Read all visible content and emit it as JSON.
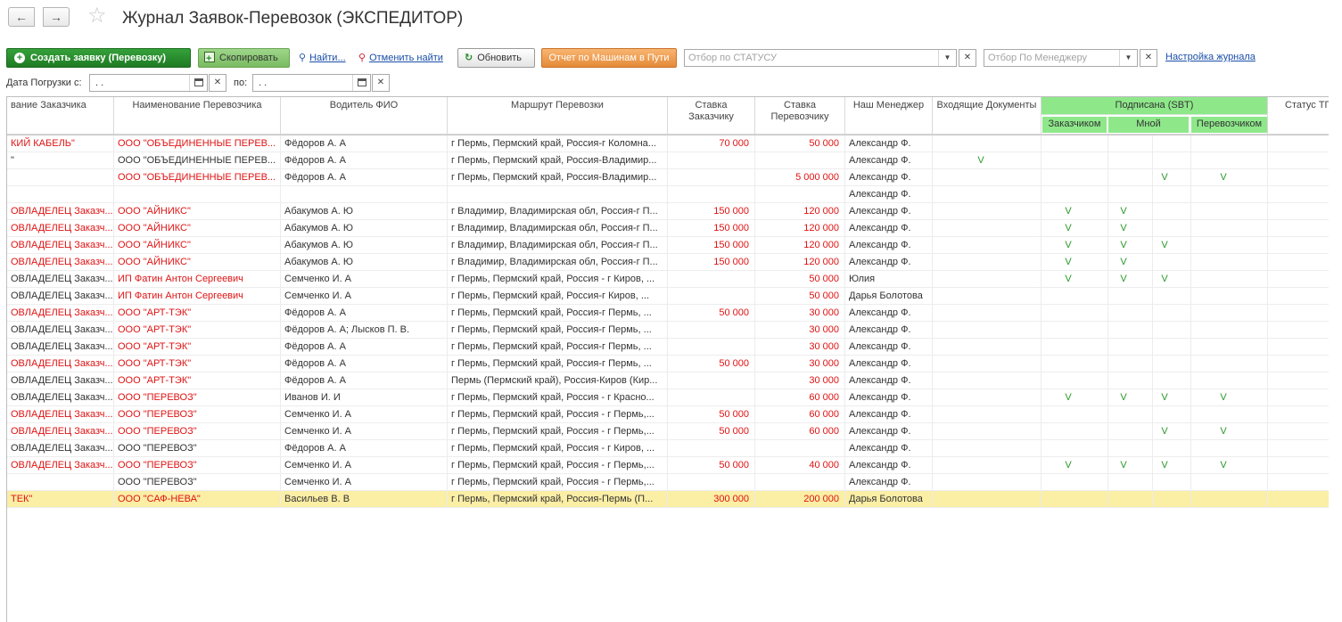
{
  "window": {
    "title": "Журнал Заявок-Перевозок (ЭКСПЕДИТОР)"
  },
  "toolbar": {
    "create_label": "Создать заявку (Перевозку)",
    "copy_label": "Скопировать",
    "find_label": "Найти...",
    "cancel_find_label": "Отменить найти",
    "refresh_label": "Обновить",
    "report_label": "Отчет по Машинам в Пути",
    "status_filter_placeholder": "Отбор по СТАТУСУ",
    "manager_filter_placeholder": "Отбор По Менеджеру",
    "settings_label": "Настройка журнала"
  },
  "dates": {
    "from_label": "Дата Погрузки с:",
    "from_value": ". .",
    "to_label": "по:",
    "to_value": ". ."
  },
  "icons": {
    "back": "arrow-left-icon",
    "forward": "arrow-right-icon",
    "favorite": "star-icon",
    "create": "plus-circle-icon",
    "copy": "copy-icon",
    "find": "magnifier-icon",
    "cancel_find": "magnifier-cross-icon",
    "refresh": "refresh-icon",
    "calendar": "calendar-icon",
    "clear": "close-icon",
    "dropdown": "chevron-down-icon"
  },
  "colors": {
    "accent_green": "#2a8c2f",
    "report_orange": "#e58a38",
    "signed_header_green": "#8ee88a",
    "red_text": "#e01313",
    "selected_row": "#fbeea5",
    "check_green": "#2a9a2a"
  },
  "table": {
    "headers": {
      "customer": "вание Заказчика",
      "carrier": "Наименование Перевозчика",
      "driver": "Водитель ФИО",
      "route": "Маршрут Перевозки",
      "rate_customer_1": "Ставка",
      "rate_customer_2": "Заказчику",
      "rate_carrier_1": "Ставка",
      "rate_carrier_2": "Перевозчику",
      "manager": "Наш Менеджер",
      "docs": "Входящие Документы",
      "signed": "Подписана (SBT)",
      "signed_customer": "Заказчиком",
      "signed_me": "Мной",
      "signed_carrier": "Перевозчиком",
      "status": "Статус ТП"
    },
    "rows": [
      {
        "customer": "КИЙ КАБЕЛЬ\"",
        "customer_red": true,
        "carrier": "ООО \"ОБЪЕДИНЕННЫЕ ПЕРЕВ...",
        "carrier_red": true,
        "driver": "Фёдоров А. А",
        "route": "г Пермь,  Пермский край, Россия-г Коломна...",
        "rate_customer": "70 000",
        "rate_carrier": "50 000",
        "manager": "Александр Ф.",
        "docs": "",
        "s1": "",
        "s2": "",
        "s3": "",
        "s4": ""
      },
      {
        "customer": "\"",
        "customer_red": false,
        "carrier": "ООО \"ОБЪЕДИНЕННЫЕ ПЕРЕВ...",
        "carrier_red": false,
        "driver": "Фёдоров А. А",
        "route": "г Пермь,  Пермский край, Россия-Владимир...",
        "rate_customer": "",
        "rate_carrier": "",
        "manager": "Александр Ф.",
        "docs": "V",
        "s1": "",
        "s2": "",
        "s3": "",
        "s4": ""
      },
      {
        "customer": "",
        "customer_red": false,
        "carrier": "ООО \"ОБЪЕДИНЕННЫЕ ПЕРЕВ...",
        "carrier_red": true,
        "driver": "Фёдоров А. А",
        "route": "г Пермь,  Пермский край, Россия-Владимир...",
        "rate_customer": "",
        "rate_carrier": "5 000 000",
        "manager": "Александр Ф.",
        "docs": "",
        "s1": "",
        "s2": "",
        "s3": "V",
        "s4": "V"
      },
      {
        "customer": "",
        "customer_red": false,
        "carrier": "",
        "carrier_red": false,
        "driver": "",
        "route": "",
        "rate_customer": "",
        "rate_carrier": "",
        "manager": "Александр Ф.",
        "docs": "",
        "s1": "",
        "s2": "",
        "s3": "",
        "s4": ""
      },
      {
        "customer": "ОВЛАДЕЛЕЦ Заказч...",
        "customer_red": true,
        "carrier": "ООО \"АЙНИКС\"",
        "carrier_red": true,
        "driver": "Абакумов А. Ю",
        "route": "г Владимир,  Владимирская обл, Россия-г П...",
        "rate_customer": "150 000",
        "rate_carrier": "120 000",
        "manager": "Александр Ф.",
        "docs": "",
        "s1": "V",
        "s2": "V",
        "s3": "",
        "s4": ""
      },
      {
        "customer": "ОВЛАДЕЛЕЦ Заказч...",
        "customer_red": true,
        "carrier": "ООО \"АЙНИКС\"",
        "carrier_red": true,
        "driver": "Абакумов А. Ю",
        "route": "г Владимир,  Владимирская обл, Россия-г П...",
        "rate_customer": "150 000",
        "rate_carrier": "120 000",
        "manager": "Александр Ф.",
        "docs": "",
        "s1": "V",
        "s2": "V",
        "s3": "",
        "s4": ""
      },
      {
        "customer": "ОВЛАДЕЛЕЦ Заказч...",
        "customer_red": true,
        "carrier": "ООО \"АЙНИКС\"",
        "carrier_red": true,
        "driver": "Абакумов А. Ю",
        "route": "г Владимир,  Владимирская обл, Россия-г П...",
        "rate_customer": "150 000",
        "rate_carrier": "120 000",
        "manager": "Александр Ф.",
        "docs": "",
        "s1": "V",
        "s2": "V",
        "s3": "V",
        "s4": ""
      },
      {
        "customer": "ОВЛАДЕЛЕЦ Заказч...",
        "customer_red": true,
        "carrier": "ООО \"АЙНИКС\"",
        "carrier_red": true,
        "driver": "Абакумов А. Ю",
        "route": "г Владимир,  Владимирская обл, Россия-г П...",
        "rate_customer": "150 000",
        "rate_carrier": "120 000",
        "manager": "Александр Ф.",
        "docs": "",
        "s1": "V",
        "s2": "V",
        "s3": "",
        "s4": ""
      },
      {
        "customer": "ОВЛАДЕЛЕЦ Заказч...",
        "customer_red": false,
        "carrier": "ИП Фатин Антон Сергеевич",
        "carrier_red": true,
        "driver": "Семченко И. А",
        "route": "г Пермь,  Пермский край, Россия - г Киров,  ...",
        "rate_customer": "",
        "rate_carrier": "50 000",
        "manager": "Юлия",
        "docs": "",
        "s1": "V",
        "s2": "V",
        "s3": "V",
        "s4": ""
      },
      {
        "customer": "ОВЛАДЕЛЕЦ Заказч...",
        "customer_red": false,
        "carrier": "ИП Фатин Антон Сергеевич",
        "carrier_red": true,
        "driver": "Семченко И. А",
        "route": "г Пермь,  Пермский край, Россия-г Киров,  ...",
        "rate_customer": "",
        "rate_carrier": "50 000",
        "manager": "Дарья Болотова",
        "docs": "",
        "s1": "",
        "s2": "",
        "s3": "",
        "s4": ""
      },
      {
        "customer": "ОВЛАДЕЛЕЦ Заказч...",
        "customer_red": true,
        "carrier": "ООО \"АРТ-ТЭК\"",
        "carrier_red": true,
        "driver": "Фёдоров А. А",
        "route": "г Пермь,  Пермский край, Россия-г Пермь,  ...",
        "rate_customer": "50 000",
        "rate_carrier": "30 000",
        "manager": "Александр Ф.",
        "docs": "",
        "s1": "",
        "s2": "",
        "s3": "",
        "s4": ""
      },
      {
        "customer": "ОВЛАДЕЛЕЦ Заказч...",
        "customer_red": false,
        "carrier": "ООО \"АРТ-ТЭК\"",
        "carrier_red": true,
        "driver": "Фёдоров А. А; Лысков П. В.",
        "route": "г Пермь,  Пермский край, Россия-г Пермь,  ...",
        "rate_customer": "",
        "rate_carrier": "30 000",
        "manager": "Александр Ф.",
        "docs": "",
        "s1": "",
        "s2": "",
        "s3": "",
        "s4": ""
      },
      {
        "customer": "ОВЛАДЕЛЕЦ Заказч...",
        "customer_red": false,
        "carrier": "ООО \"АРТ-ТЭК\"",
        "carrier_red": true,
        "driver": "Фёдоров А. А",
        "route": "г Пермь,  Пермский край, Россия-г Пермь,  ...",
        "rate_customer": "",
        "rate_carrier": "30 000",
        "manager": "Александр Ф.",
        "docs": "",
        "s1": "",
        "s2": "",
        "s3": "",
        "s4": ""
      },
      {
        "customer": "ОВЛАДЕЛЕЦ Заказч...",
        "customer_red": true,
        "carrier": "ООО \"АРТ-ТЭК\"",
        "carrier_red": true,
        "driver": "Фёдоров А. А",
        "route": "г Пермь,  Пермский край, Россия-г Пермь,  ...",
        "rate_customer": "50 000",
        "rate_carrier": "30 000",
        "manager": "Александр Ф.",
        "docs": "",
        "s1": "",
        "s2": "",
        "s3": "",
        "s4": ""
      },
      {
        "customer": "ОВЛАДЕЛЕЦ Заказч...",
        "customer_red": false,
        "carrier": "ООО \"АРТ-ТЭК\"",
        "carrier_red": true,
        "driver": "Фёдоров А. А",
        "route": "Пермь (Пермский край), Россия-Киров (Кир...",
        "rate_customer": "",
        "rate_carrier": "30 000",
        "manager": "Александр Ф.",
        "docs": "",
        "s1": "",
        "s2": "",
        "s3": "",
        "s4": ""
      },
      {
        "customer": "ОВЛАДЕЛЕЦ Заказч...",
        "customer_red": false,
        "carrier": "ООО \"ПЕРЕВОЗ\"",
        "carrier_red": true,
        "driver": "Иванов И. И",
        "route": "г Пермь,  Пермский край, Россия - г Красно...",
        "rate_customer": "",
        "rate_carrier": "60 000",
        "manager": "Александр Ф.",
        "docs": "",
        "s1": "V",
        "s2": "V",
        "s3": "V",
        "s4": "V"
      },
      {
        "customer": "ОВЛАДЕЛЕЦ Заказч...",
        "customer_red": true,
        "carrier": "ООО \"ПЕРЕВОЗ\"",
        "carrier_red": true,
        "driver": "Семченко И. А",
        "route": "г Пермь,  Пермский край, Россия - г Пермь,...",
        "rate_customer": "50 000",
        "rate_carrier": "60 000",
        "manager": "Александр Ф.",
        "docs": "",
        "s1": "",
        "s2": "",
        "s3": "",
        "s4": ""
      },
      {
        "customer": "ОВЛАДЕЛЕЦ Заказч...",
        "customer_red": true,
        "carrier": "ООО \"ПЕРЕВОЗ\"",
        "carrier_red": true,
        "driver": "Семченко И. А",
        "route": "г Пермь,  Пермский край, Россия - г Пермь,...",
        "rate_customer": "50 000",
        "rate_carrier": "60 000",
        "manager": "Александр Ф.",
        "docs": "",
        "s1": "",
        "s2": "",
        "s3": "V",
        "s4": "V"
      },
      {
        "customer": "ОВЛАДЕЛЕЦ Заказч...",
        "customer_red": false,
        "carrier": "ООО \"ПЕРЕВОЗ\"",
        "carrier_red": false,
        "driver": "Фёдоров А. А",
        "route": "г Пермь,  Пермский край, Россия - г Киров,  ...",
        "rate_customer": "",
        "rate_carrier": "",
        "manager": "Александр Ф.",
        "docs": "",
        "s1": "",
        "s2": "",
        "s3": "",
        "s4": ""
      },
      {
        "customer": "ОВЛАДЕЛЕЦ Заказч...",
        "customer_red": true,
        "carrier": "ООО \"ПЕРЕВОЗ\"",
        "carrier_red": true,
        "driver": "Семченко И. А",
        "route": "г Пермь,  Пермский край, Россия - г Пермь,...",
        "rate_customer": "50 000",
        "rate_carrier": "40 000",
        "manager": "Александр Ф.",
        "docs": "",
        "s1": "V",
        "s2": "V",
        "s3": "V",
        "s4": "V"
      },
      {
        "customer": "",
        "customer_red": false,
        "carrier": "ООО \"ПЕРЕВОЗ\"",
        "carrier_red": false,
        "driver": "Семченко И. А",
        "route": "г Пермь,  Пермский край, Россия - г Пермь,...",
        "rate_customer": "",
        "rate_carrier": "",
        "manager": "Александр Ф.",
        "docs": "",
        "s1": "",
        "s2": "",
        "s3": "",
        "s4": ""
      },
      {
        "customer": "ТЕК\"",
        "customer_red": true,
        "carrier": "ООО \"САФ-НЕВА\"",
        "carrier_red": true,
        "driver": "Васильев В. В",
        "route": "г Пермь,  Пермский край, Россия-Пермь (П...",
        "rate_customer": "300 000",
        "rate_carrier": "200 000",
        "manager": "Дарья Болотова",
        "docs": "",
        "s1": "",
        "s2": "",
        "s3": "",
        "s4": "",
        "selected": true
      }
    ]
  }
}
